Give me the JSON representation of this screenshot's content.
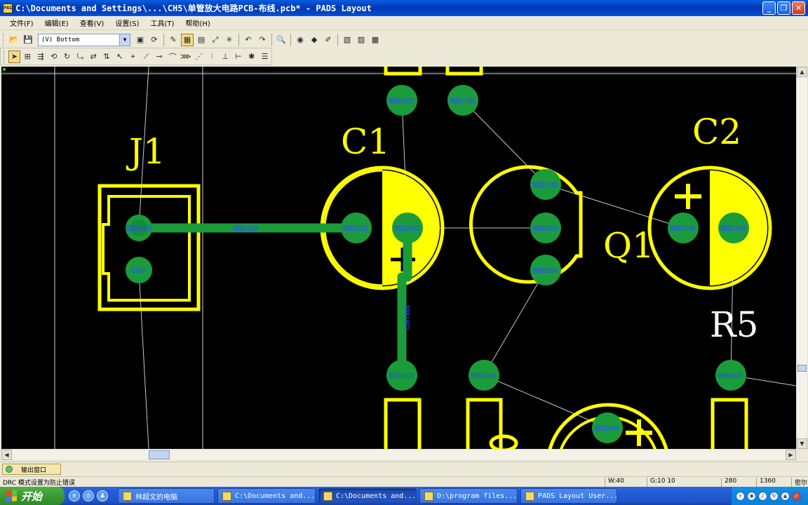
{
  "window": {
    "title": "C:\\Documents and Settings\\...\\CH5\\单管放大电路PCB-布线.pcb* - PADS Layout",
    "app_icon_text": "PADS",
    "minimize": "_",
    "maximize": "❐",
    "close": "✕"
  },
  "menu": {
    "items": [
      "文件(F)",
      "编辑(E)",
      "查看(V)",
      "设置(S)",
      "工具(T)",
      "帮助(H)"
    ]
  },
  "toolbar": {
    "layer_value": "(V) Bottom"
  },
  "pcb": {
    "components": [
      {
        "ref": "J1"
      },
      {
        "ref": "C1"
      },
      {
        "ref": "C2"
      },
      {
        "ref": "Q1"
      },
      {
        "ref": "R5"
      }
    ],
    "pad_labels": {
      "j1_pin1": "$$$1818",
      "j1_pin2": "GND",
      "trace_1818": "$$$1818",
      "c1_pin1": "$$$1818",
      "c1_pin2": "$$$1802",
      "top_left_via": "$$$1802",
      "top_right_via": "$$$1748",
      "q1_top": "$$$1748",
      "q1_mid": "$$$1802",
      "q1_bot": "$$$2094",
      "c2_pin1": "$$$1748",
      "c2_pin2": "$$$1906",
      "trace_1802_v": "$$$1802",
      "bottom_via_1": "$$$1802",
      "bottom_via_2": "$$$2094",
      "bottom_via_3": "$$$1906",
      "bottom_cap": "$$$2094"
    }
  },
  "output_window": {
    "label": "输出窗口"
  },
  "status": {
    "message": "DRC 模式设置为防止错误",
    "width": "W:40",
    "grid": "G:10 10",
    "x": "280",
    "y": "1360",
    "unit": "密尔"
  },
  "taskbar": {
    "start": "开始",
    "tasks": [
      {
        "label": "林超文的电脑",
        "active": false
      },
      {
        "label": "C:\\Documents and...",
        "active": false
      },
      {
        "label": "C:\\Documents and...",
        "active": true
      },
      {
        "label": "D:\\program files...",
        "active": false
      },
      {
        "label": "PADS Layout User...",
        "active": false
      }
    ]
  }
}
